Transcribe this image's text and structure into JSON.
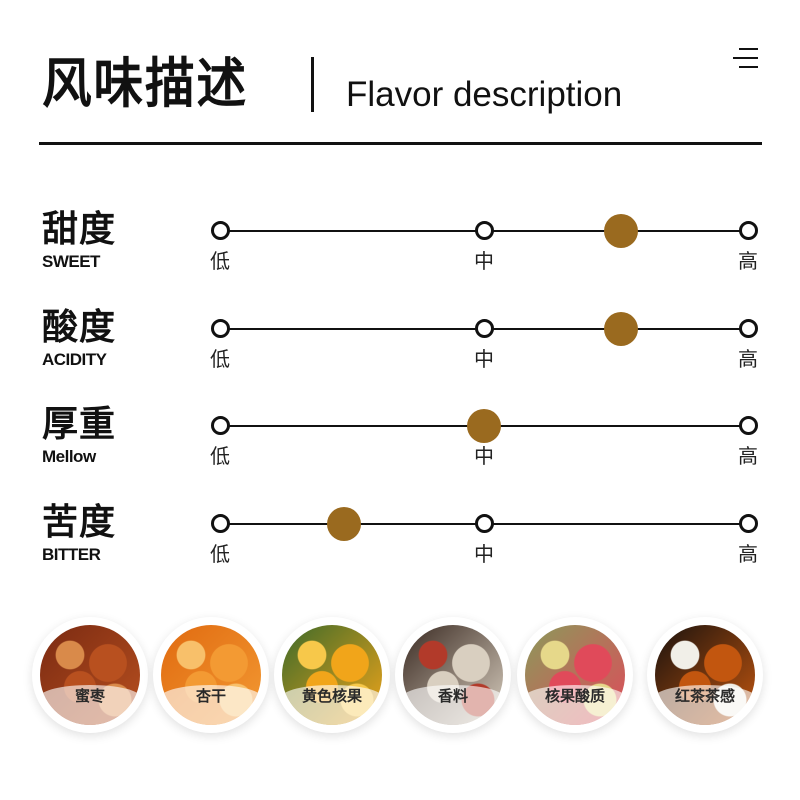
{
  "header": {
    "title_cn": "风味描述",
    "title_en": "Flavor description",
    "menu_icon": "menu-icon"
  },
  "scale_labels": {
    "low": "低",
    "mid": "中",
    "high": "高"
  },
  "accent_color": "#9A6A1F",
  "attributes": [
    {
      "name_cn": "甜度",
      "name_en": "SWEET",
      "value": 0.76
    },
    {
      "name_cn": "酸度",
      "name_en": "ACIDITY",
      "value": 0.76
    },
    {
      "name_cn": "厚重",
      "name_en": "Mellow",
      "value": 0.5
    },
    {
      "name_cn": "苦度",
      "name_en": "BITTER",
      "value": 0.235
    }
  ],
  "aromas": [
    {
      "label": "蜜枣",
      "image": "dates",
      "colors": [
        "#7a2a12",
        "#b8501f",
        "#d98a4a"
      ]
    },
    {
      "label": "杏干",
      "image": "dried-apricots",
      "colors": [
        "#e06a10",
        "#f39a33",
        "#f8c06a"
      ]
    },
    {
      "label": "黄色核果",
      "image": "yellow-stone-fruit",
      "colors": [
        "#3d6a2a",
        "#f1a51a",
        "#f7c84a"
      ]
    },
    {
      "label": "香料",
      "image": "spices",
      "colors": [
        "#3a2a22",
        "#d9cfc0",
        "#b23a2a"
      ]
    },
    {
      "label": "核果酸质",
      "image": "red-berries",
      "colors": [
        "#8a9a5a",
        "#e04a5a",
        "#e6d88a"
      ]
    },
    {
      "label": "红茶茶感",
      "image": "black-tea",
      "colors": [
        "#1a120e",
        "#c2560f",
        "#f1efe8"
      ]
    }
  ]
}
